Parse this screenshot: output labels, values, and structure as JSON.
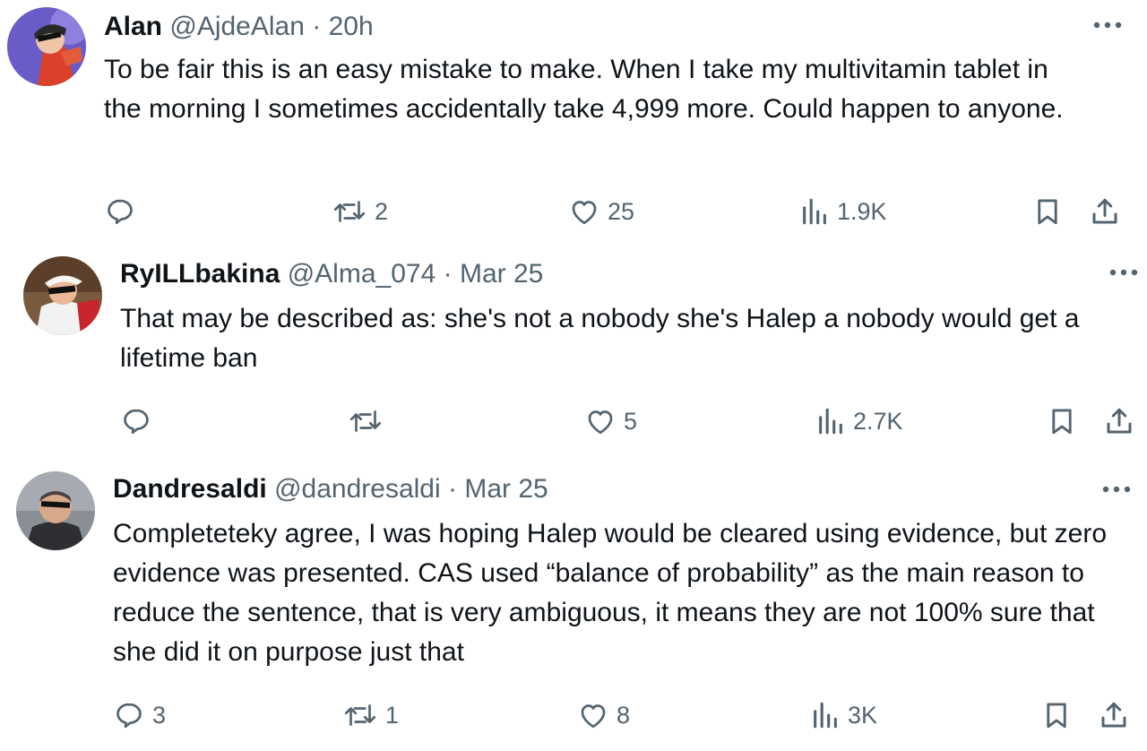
{
  "tweets": [
    {
      "name": "Alan",
      "handle": "@AjdeAlan",
      "separator": "·",
      "time": "20h",
      "text": "To be fair this is an easy mistake to make. When I take my multivitamin tablet in the morning I sometimes accidentally take 4,999 more. Could happen to anyone.",
      "reply_count": "",
      "retweet_count": "2",
      "like_count": "25",
      "view_count": "1.9K"
    },
    {
      "name": "RyILLbakina",
      "handle": "@Alma_074",
      "separator": "·",
      "time": "Mar 25",
      "text": "That may be described as: she's not a nobody she's Halep a nobody would get a lifetime ban",
      "reply_count": "",
      "retweet_count": "",
      "like_count": "5",
      "view_count": "2.7K"
    },
    {
      "name": "Dandresaldi",
      "handle": "@dandresaldi",
      "separator": "·",
      "time": "Mar 25",
      "text": "Completeteky agree, I was hoping Halep would be cleared using evidence, but zero evidence was presented. CAS used “balance of probability” as the main reason to reduce the sentence, that is very ambiguous, it means they are  not 100% sure that she did it on purpose just that",
      "reply_count": "3",
      "retweet_count": "1",
      "like_count": "8",
      "view_count": "3K"
    }
  ],
  "icons": {
    "reply": "speech-bubble-icon",
    "retweet": "retweet-arrows-icon",
    "like": "heart-outline-icon",
    "views": "bar-chart-icon",
    "bookmark": "bookmark-icon",
    "share": "share-upload-icon",
    "more": "more-dots-icon"
  },
  "colors": {
    "text": "#0f1419",
    "secondary": "#536471"
  }
}
